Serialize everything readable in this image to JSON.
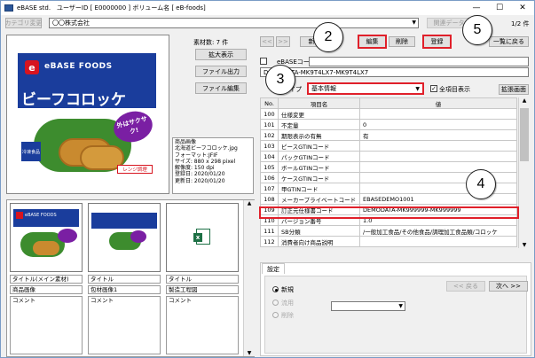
{
  "window": {
    "title": "eBASE std.　ユーザーID [ E0000000 ]  ボリューム名 [ eB-foods]",
    "min_glyph": "—",
    "max_glyph": "☐",
    "close_glyph": "✕"
  },
  "toolbar": {
    "category_button": "カテゴリ変更",
    "company_value": "〇〇株式会社",
    "related_data_button": "関連データ",
    "count": "1/2 件"
  },
  "left_panel": {
    "material_count": "素材数: 7 件",
    "enlarge_button": "拡大表示",
    "file_output_button": "ファイル出力",
    "file_edit_button": "ファイル編集",
    "product_image": {
      "brand": "eBASE FOODS",
      "logo_letter": "e",
      "product_name": "ビーフコロッケ",
      "badge": "外はサクサク!",
      "tag": "レンジ調理",
      "sub_label": "冷凍食品"
    },
    "file_info": [
      "商品画像",
      "北海道ビーフコロッケ.jpg",
      "フォーマット:JFIF",
      "サイズ: 880 x 298 pixel",
      "解像度: 150 dpi",
      "登録日: 2020/01/20",
      "更新日: 2020/01/20"
    ],
    "thumbnails": [
      {
        "title": "タイトル(メイン素材)",
        "name": "商品画像",
        "comment": "コメント"
      },
      {
        "title": "タイトル",
        "name": "包材画像1",
        "comment": "コメント"
      },
      {
        "title": "タイトル",
        "name": "製造工程図",
        "comment": "コメント"
      }
    ]
  },
  "right_panel": {
    "nav_prev": "<<",
    "nav_next": ">>",
    "new_button": "新",
    "edit_button": "編集",
    "delete_button": "削除",
    "register_button": "登録",
    "back_list_button": "一覧に戻る",
    "ebase_code_label": "eBASEコード",
    "ebase_code_value": "DEMODATA-MK9T4LX7-MK9T4LX7",
    "type_label": "タイプ",
    "type_value": "基本情報",
    "show_all_label": "全項目表示",
    "expand_button": "拡張画面",
    "table_headers": [
      "No.",
      "項目名",
      "値"
    ],
    "rows": [
      {
        "no": "100",
        "name": "仕様変更",
        "value": ""
      },
      {
        "no": "101",
        "name": "不定量",
        "value": "0"
      },
      {
        "no": "102",
        "name": "期限表示の有無",
        "value": "有"
      },
      {
        "no": "103",
        "name": "ピースGTINコード",
        "value": ""
      },
      {
        "no": "104",
        "name": "パックGTINコード",
        "value": ""
      },
      {
        "no": "105",
        "name": "ボールGTINコード",
        "value": ""
      },
      {
        "no": "106",
        "name": "ケースGTINコード",
        "value": ""
      },
      {
        "no": "107",
        "name": "甲GTINコード",
        "value": ""
      },
      {
        "no": "108",
        "name": "メーカープライベートコード",
        "value": "EBASEDEMO1001"
      },
      {
        "no": "109",
        "name": "訂正元仕様書コード",
        "value": "DEMODATA-MK999999-MK999999"
      },
      {
        "no": "110",
        "name": "バージョン番号",
        "value": "1.0"
      },
      {
        "no": "111",
        "name": "SB分類",
        "value": "/一般加工食品/その他食品/調理加工食品類/コロッケ"
      },
      {
        "no": "112",
        "name": "消費者向け商品説明",
        "value": ""
      }
    ],
    "settings_tab": "設定",
    "radio_new": "新規",
    "radio_copy": "流用",
    "radio_delete": "削除",
    "prev_button": "<< 戻る",
    "next_button": "次へ >>"
  },
  "callouts": [
    "2",
    "3",
    "4",
    "5"
  ]
}
